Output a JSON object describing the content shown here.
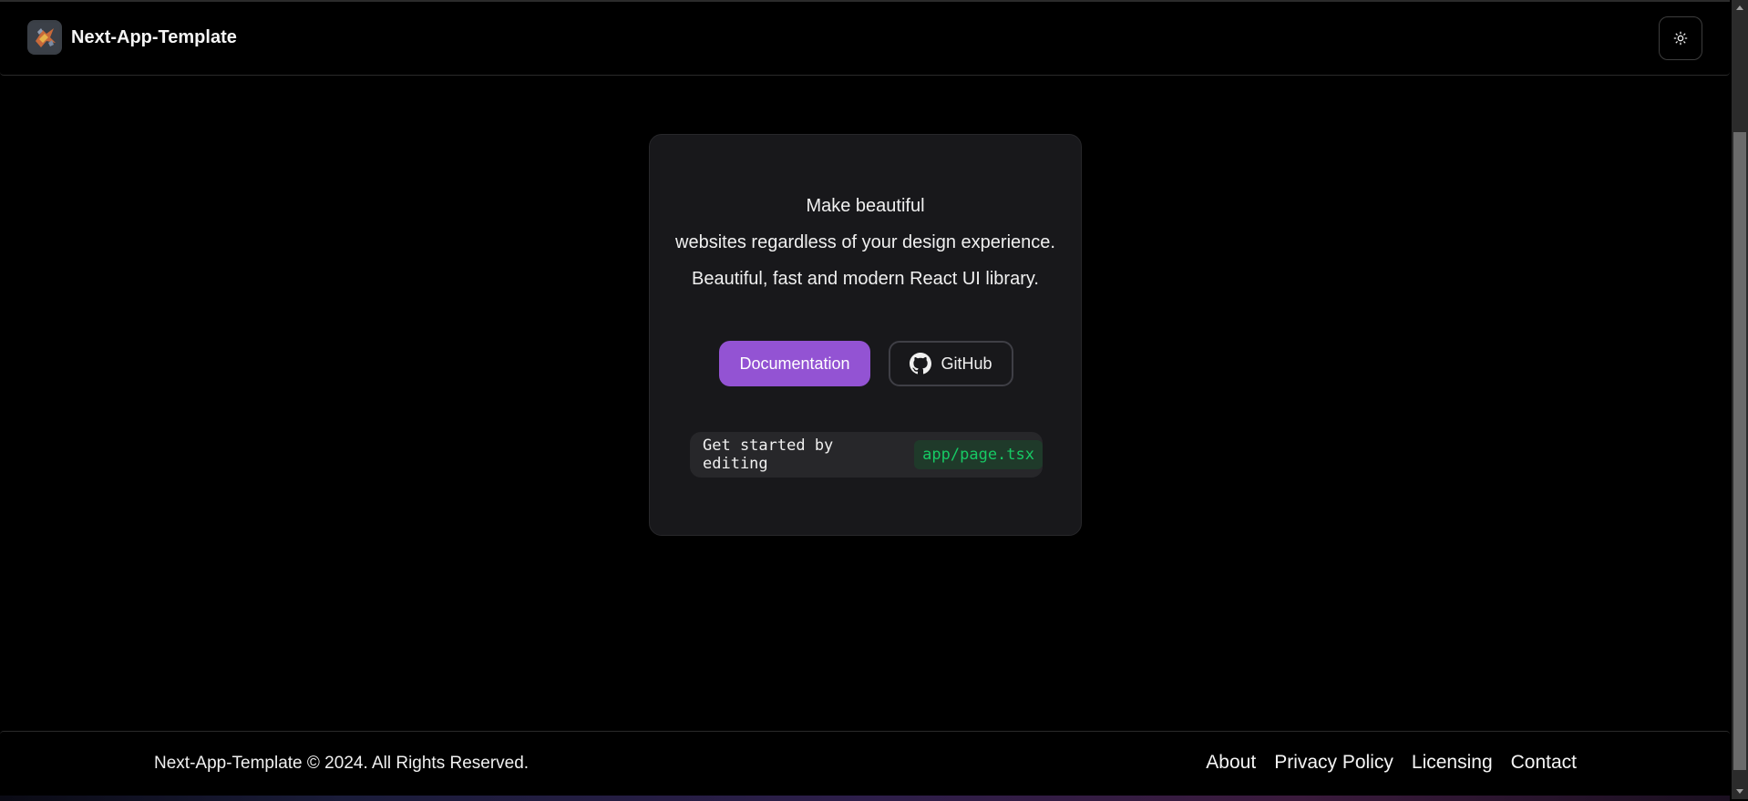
{
  "navbar": {
    "brand_title": "Next-App-Template",
    "logo_icon": "app-logo-icon",
    "theme_toggle_icon": "sun-icon"
  },
  "hero": {
    "lines": [
      "Make beautiful",
      "websites regardless of your design experience.",
      "Beautiful, fast and modern React UI library."
    ]
  },
  "buttons": {
    "documentation_label": "Documentation",
    "github_label": "GitHub",
    "github_icon": "github-icon"
  },
  "snippet": {
    "prefix": "Get started by editing",
    "code": "app/page.tsx"
  },
  "footer": {
    "copyright": "Next-App-Template © 2024. All Rights Reserved.",
    "links": [
      "About",
      "Privacy Policy",
      "Licensing",
      "Contact"
    ]
  },
  "colors": {
    "accent": "#9353d3",
    "code_text": "#17c964",
    "background": "#000000",
    "card": "#18181b"
  }
}
